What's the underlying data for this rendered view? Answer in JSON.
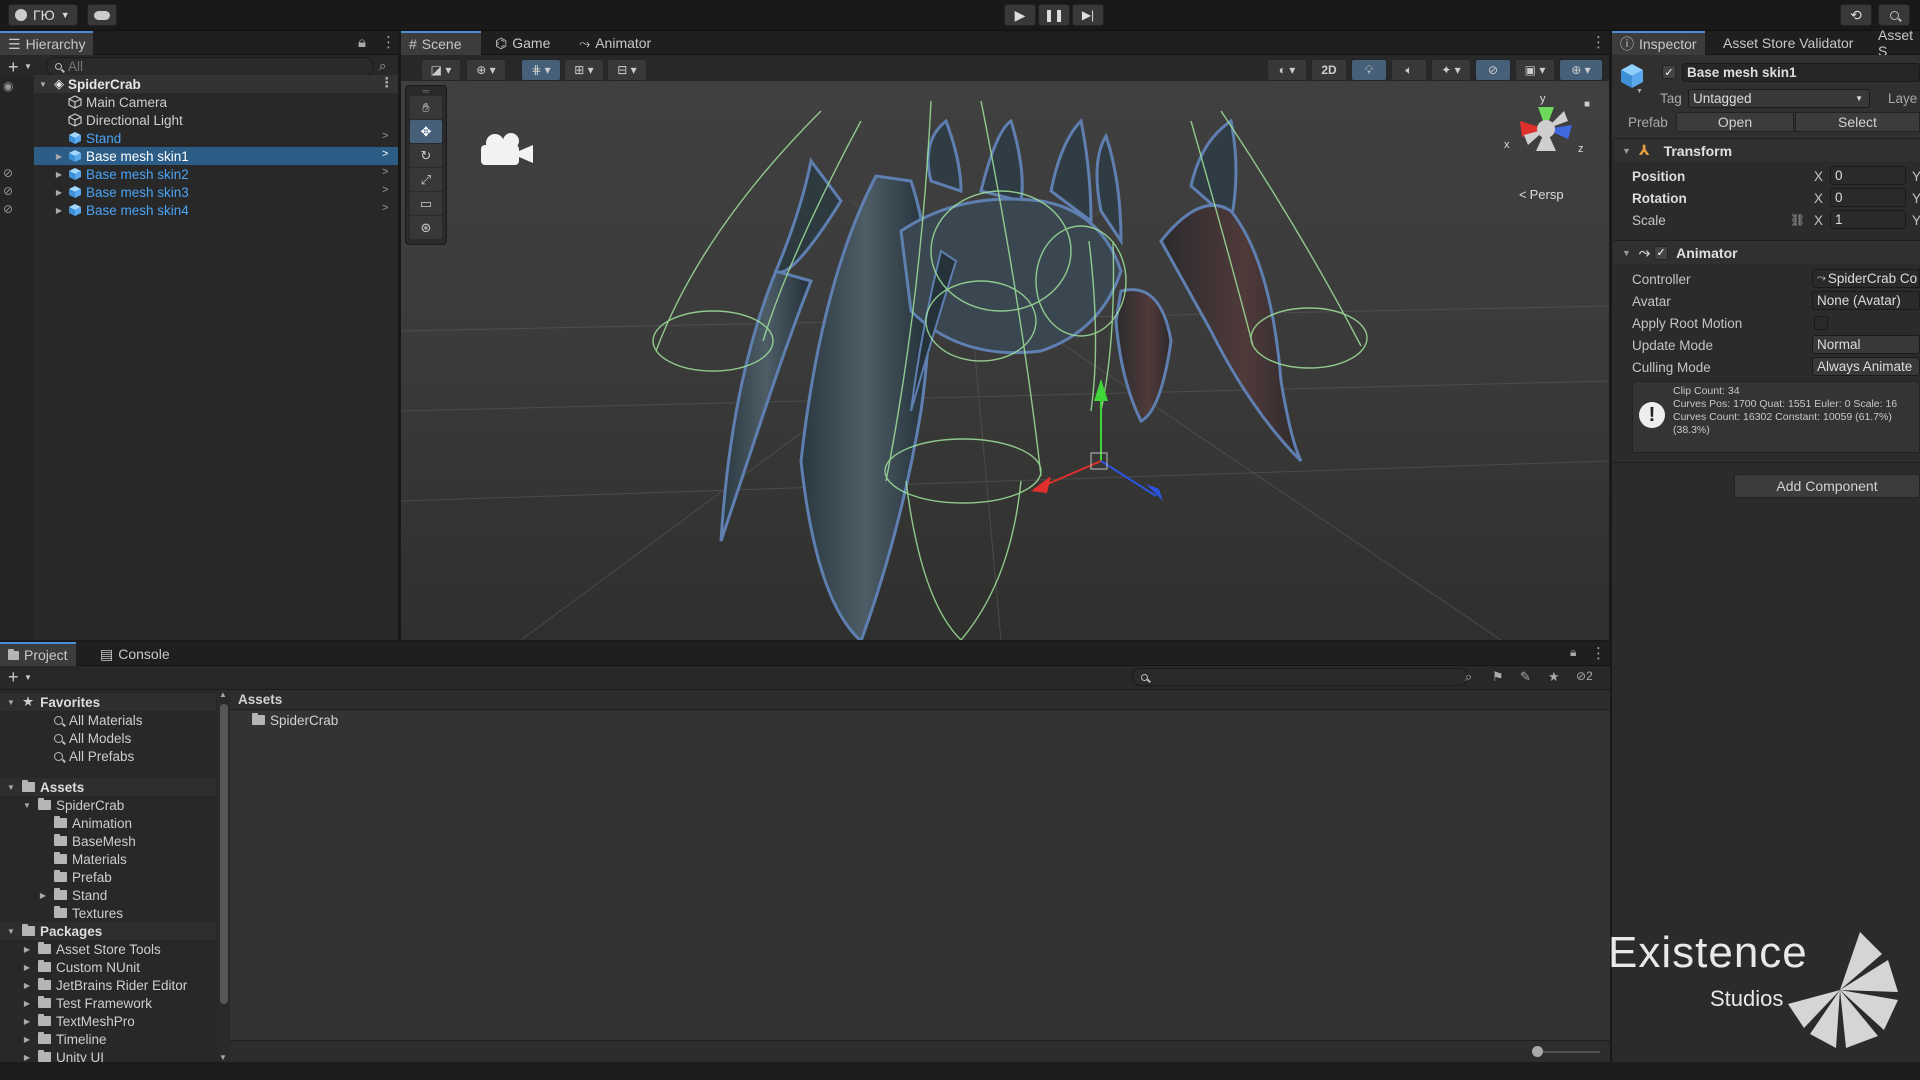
{
  "app": {
    "account_label": "ГЮ"
  },
  "hierarchy": {
    "tab_label": "Hierarchy",
    "search_placeholder": "All",
    "root": "SpiderCrab",
    "items": [
      {
        "label": "Main Camera",
        "type": "gameobject"
      },
      {
        "label": "Directional Light",
        "type": "gameobject"
      },
      {
        "label": "Stand",
        "type": "prefab"
      },
      {
        "label": "Base mesh skin1",
        "type": "prefab",
        "selected": true
      },
      {
        "label": "Base mesh skin2",
        "type": "prefab"
      },
      {
        "label": "Base mesh skin3",
        "type": "prefab"
      },
      {
        "label": "Base mesh skin4",
        "type": "prefab"
      }
    ]
  },
  "scene": {
    "tabs": [
      "Scene",
      "Game",
      "Animator"
    ],
    "toggle_2d": "2D",
    "persp_label": "Persp",
    "gizmo_axes": {
      "x": "x",
      "y": "y",
      "z": "z"
    }
  },
  "inspector": {
    "tabs": [
      "Inspector",
      "Asset Store Validator",
      "Asset S"
    ],
    "object_name": "Base mesh skin1",
    "tag_label": "Tag",
    "tag_value": "Untagged",
    "layer_label": "Laye",
    "prefab_label": "Prefab",
    "open_label": "Open",
    "select_label": "Select",
    "transform": {
      "title": "Transform",
      "position_label": "Position",
      "position_x": "0",
      "rotation_label": "Rotation",
      "rotation_x": "0",
      "scale_label": "Scale",
      "scale_x": "1",
      "axis_x": "X",
      "axis_y": "Y"
    },
    "animator": {
      "title": "Animator",
      "controller_label": "Controller",
      "controller_value": "SpiderCrab Co",
      "avatar_label": "Avatar",
      "avatar_value": "None (Avatar)",
      "root_motion_label": "Apply Root Motion",
      "update_mode_label": "Update Mode",
      "update_mode_value": "Normal",
      "culling_mode_label": "Culling Mode",
      "culling_mode_value": "Always Animate",
      "info_lines": [
        "Clip Count: 34",
        "Curves Pos: 1700 Quat: 1551 Euler: 0 Scale: 16",
        "Curves Count: 16302 Constant: 10059 (61.7%)",
        "(38.3%)"
      ]
    },
    "add_component_label": "Add Component"
  },
  "project": {
    "tabs": [
      "Project",
      "Console"
    ],
    "hidden_count": "2",
    "favorites": {
      "label": "Favorites",
      "items": [
        "All Materials",
        "All Models",
        "All Prefabs"
      ]
    },
    "assets": {
      "label": "Assets",
      "spidercrab": "SpiderCrab",
      "children": [
        "Animation",
        "BaseMesh",
        "Materials",
        "Prefab",
        "Stand",
        "Textures"
      ]
    },
    "packages": {
      "label": "Packages",
      "items": [
        "Asset Store Tools",
        "Custom NUnit",
        "JetBrains Rider Editor",
        "Test Framework",
        "TextMeshPro",
        "Timeline",
        "Unity UI"
      ]
    },
    "breadcrumb": "Assets",
    "content_items": [
      "SpiderCrab"
    ]
  },
  "watermark": {
    "line1": "Existence",
    "line2": "Studios"
  },
  "colors": {
    "accent": "#4d8fd6",
    "selection": "#2c5d87",
    "prefab_blue": "#4ba3f5"
  }
}
